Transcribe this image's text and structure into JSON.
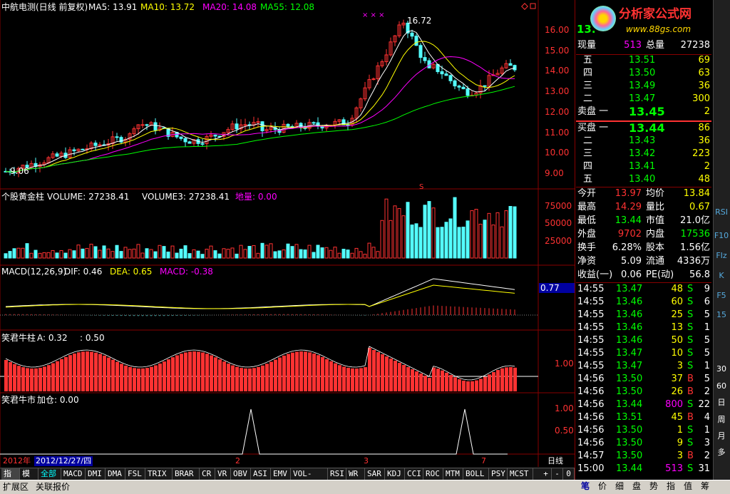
{
  "header": {
    "title": "中航电测(日线 前复权)",
    "ma5": "MA5: 13.91",
    "ma10": "MA10: 13.72",
    "ma20": "MA20: 14.08",
    "ma55": "MA55: 12.08",
    "high_label": "16.72",
    "low_label": "9.06",
    "s_marker": "S"
  },
  "colors": {
    "ma5": "#ffffff",
    "ma10": "#ffff00",
    "ma20": "#ff00ff",
    "ma55": "#00ff00",
    "up": "#ff3232",
    "down": "#54ffff",
    "bg": "#000000",
    "grid": "#880000"
  },
  "price_axis": [
    "16.00",
    "15.00",
    "14.00",
    "13.00",
    "12.00",
    "11.00",
    "10.00",
    "9.00"
  ],
  "volume_header": {
    "name": "个股黄金柱",
    "vol": "VOLUME: 27238.41",
    "vol3": "VOLUME3: 27238.41",
    "dl": "地量: 0.00"
  },
  "volume_axis": [
    "75000",
    "50000",
    "25000"
  ],
  "macd_header": {
    "name": "MACD(12,26,9)",
    "dif": "DIF: 0.46",
    "dea": "DEA: 0.65",
    "macd": "MACD: -0.38"
  },
  "macd_value": "0.77",
  "ind3_header": {
    "name": "笑君牛柱",
    "a": "A: 0.32",
    "b": ": 0.50"
  },
  "ind3_axis": [
    "1.00"
  ],
  "ind4_header": {
    "name": "笑君牛市",
    "add": "加仓: 0.00"
  },
  "ind4_axis": [
    "1.00",
    "0.50"
  ],
  "timeline": {
    "year": "2012年",
    "date": "2012/12/27/四",
    "m2": "2",
    "m3": "3",
    "m7": "7",
    "period": "日线"
  },
  "bottom_tabs": [
    "指标",
    "模板",
    "全部",
    "MACD",
    "DMI",
    "DMA",
    "FSL",
    "TRIX",
    "BRAR",
    "CR",
    "VR",
    "OBV",
    "ASI",
    "EMV",
    "VOL-TDX",
    "RSI",
    "WR",
    "SAR",
    "KDJ",
    "CCI",
    "ROC",
    "MTM",
    "BOLL",
    "PSY",
    "MCST"
  ],
  "bottom_ctrl": [
    "+",
    "-",
    "0"
  ],
  "footer_tabs": [
    "扩展区",
    "关联报价"
  ],
  "quote": {
    "code_price": "13.",
    "xianliang_label": "现量",
    "xianliang": "513",
    "zongliang_label": "总量",
    "zongliang": "27238",
    "sell": [
      {
        "label": "五",
        "price": "13.51",
        "vol": "69"
      },
      {
        "label": "四",
        "price": "13.50",
        "vol": "63"
      },
      {
        "label": "三",
        "price": "13.49",
        "vol": "36"
      },
      {
        "label": "二",
        "price": "13.47",
        "vol": "300"
      },
      {
        "label": "卖盘 一",
        "price": "13.45",
        "vol": "2"
      }
    ],
    "buy": [
      {
        "label": "买盘 一",
        "price": "13.44",
        "vol": "86"
      },
      {
        "label": "二",
        "price": "13.43",
        "vol": "36"
      },
      {
        "label": "三",
        "price": "13.42",
        "vol": "223"
      },
      {
        "label": "四",
        "price": "13.41",
        "vol": "2"
      },
      {
        "label": "五",
        "price": "13.40",
        "vol": "48"
      }
    ],
    "stats": [
      {
        "l1": "今开",
        "v1": "13.97",
        "l2": "均价",
        "v2": "13.84",
        "c1": "#ff3232",
        "c2": "#ffff00"
      },
      {
        "l1": "最高",
        "v1": "14.29",
        "l2": "量比",
        "v2": "0.67",
        "c1": "#ff3232",
        "c2": "#ffff00"
      },
      {
        "l1": "最低",
        "v1": "13.44",
        "l2": "市值",
        "v2": "21.0亿",
        "c1": "#00ff00",
        "c2": "#ffffff"
      },
      {
        "l1": "外盘",
        "v1": "9702",
        "l2": "内盘",
        "v2": "17536",
        "c1": "#ff3232",
        "c2": "#00ff00"
      },
      {
        "l1": "换手",
        "v1": "6.28%",
        "l2": "股本",
        "v2": "1.56亿",
        "c1": "#ffffff",
        "c2": "#ffffff"
      },
      {
        "l1": "净资",
        "v1": "5.09",
        "l2": "流通",
        "v2": "4336万",
        "c1": "#ffffff",
        "c2": "#ffffff"
      },
      {
        "l1": "收益(一)",
        "v1": "0.06",
        "l2": "PE(动)",
        "v2": "56.8",
        "c1": "#ffffff",
        "c2": "#ffffff"
      }
    ],
    "ticks": [
      {
        "time": "14:55",
        "price": "13.47",
        "vol": "48",
        "bs": "S",
        "n": "9"
      },
      {
        "time": "14:55",
        "price": "13.46",
        "vol": "60",
        "bs": "S",
        "n": "6"
      },
      {
        "time": "14:55",
        "price": "13.46",
        "vol": "25",
        "bs": "S",
        "n": "5"
      },
      {
        "time": "14:55",
        "price": "13.46",
        "vol": "13",
        "bs": "S",
        "n": "1"
      },
      {
        "time": "14:55",
        "price": "13.46",
        "vol": "50",
        "bs": "S",
        "n": "5"
      },
      {
        "time": "14:55",
        "price": "13.47",
        "vol": "10",
        "bs": "S",
        "n": "5"
      },
      {
        "time": "14:55",
        "price": "13.47",
        "vol": "3",
        "bs": "S",
        "n": "1"
      },
      {
        "time": "14:56",
        "price": "13.50",
        "vol": "37",
        "bs": "B",
        "n": "5"
      },
      {
        "time": "14:56",
        "price": "13.50",
        "vol": "26",
        "bs": "B",
        "n": "2"
      },
      {
        "time": "14:56",
        "price": "13.44",
        "vol": "800",
        "bs": "S",
        "n": "22"
      },
      {
        "time": "14:56",
        "price": "13.51",
        "vol": "45",
        "bs": "B",
        "n": "4"
      },
      {
        "time": "14:56",
        "price": "13.50",
        "vol": "1",
        "bs": "S",
        "n": "1"
      },
      {
        "time": "14:56",
        "price": "13.50",
        "vol": "9",
        "bs": "S",
        "n": "3"
      },
      {
        "time": "14:57",
        "price": "13.50",
        "vol": "3",
        "bs": "B",
        "n": "2"
      },
      {
        "time": "15:00",
        "price": "13.44",
        "vol": "513",
        "bs": "S",
        "n": "31"
      }
    ],
    "bottom_tabs": [
      "笔",
      "价",
      "细",
      "盘",
      "势",
      "指",
      "值",
      "筹"
    ]
  },
  "right_toolbar": [
    "RSI",
    "F10",
    "FIz",
    "K",
    "F5",
    "15",
    "30",
    "60",
    "日",
    "周",
    "月",
    "多"
  ],
  "logo": {
    "title": "分析家公式网",
    "url": "www.88gs.com"
  }
}
